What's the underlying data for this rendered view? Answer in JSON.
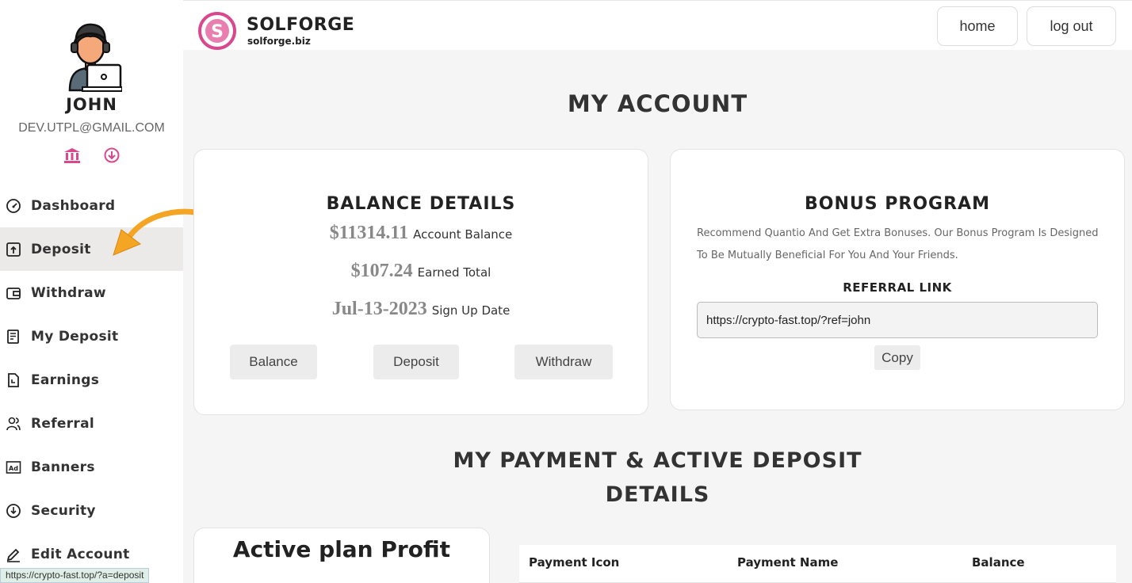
{
  "sidebar": {
    "user": {
      "name": "JOHN",
      "email": "DEV.UTPL@GMAIL.COM"
    },
    "items": [
      {
        "label": "Dashboard",
        "icon": "dashboard-gauge-icon"
      },
      {
        "label": "Deposit",
        "icon": "deposit-icon"
      },
      {
        "label": "Withdraw",
        "icon": "wallet-icon"
      },
      {
        "label": "My Deposit",
        "icon": "document-list-icon"
      },
      {
        "label": "Earnings",
        "icon": "earnings-doc-icon"
      },
      {
        "label": "Referral",
        "icon": "users-icon"
      },
      {
        "label": "Banners",
        "icon": "ad-icon"
      },
      {
        "label": "Security",
        "icon": "security-arrow-icon"
      },
      {
        "label": "Edit Account",
        "icon": "pencil-icon"
      }
    ],
    "active_index": 1
  },
  "header": {
    "brand": "SOLFORGE",
    "brand_sub": "solforge.biz",
    "home_label": "home",
    "logout_label": "log out"
  },
  "main": {
    "title": "MY ACCOUNT",
    "balance": {
      "title": "BALANCE DETAILS",
      "account_balance": "$11314.11",
      "account_balance_label": "Account Balance",
      "earned_total": "$107.24",
      "earned_total_label": "Earned Total",
      "signup_date": "Jul-13-2023",
      "signup_date_label": "Sign Up Date",
      "btn_balance": "Balance",
      "btn_deposit": "Deposit",
      "btn_withdraw": "Withdraw"
    },
    "bonus": {
      "title": "BONUS PROGRAM",
      "description": "Recommend Quantio And Get Extra Bonuses. Our Bonus Program Is Designed To Be Mutually Beneficial For You And Your Friends.",
      "referral_label": "REFERRAL LINK",
      "referral_link": "https://crypto-fast.top/?ref=john",
      "copy_label": "Copy"
    },
    "section_title_line1": "MY PAYMENT & ACTIVE DEPOSIT",
    "section_title_line2": "DETAILS",
    "profit_title": "Active plan Profit",
    "table_headers": [
      "Payment Icon",
      "Payment Name",
      "Balance"
    ]
  },
  "status_bar": {
    "url": "https://crypto-fast.top/?a=deposit"
  },
  "colors": {
    "accent_pink": "#d9478c",
    "arrow_orange": "#f5a524",
    "background": "#f6f5f5"
  }
}
